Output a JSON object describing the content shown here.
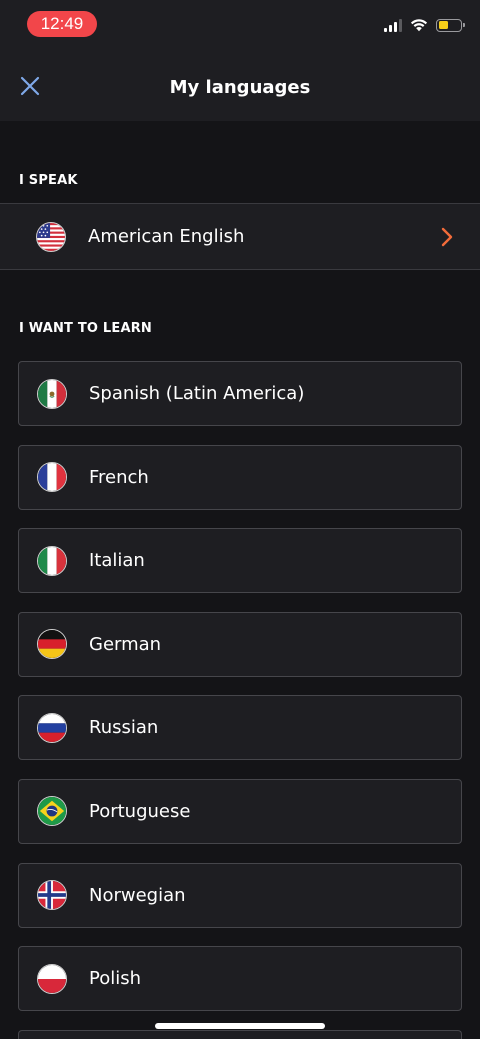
{
  "status_bar": {
    "time": "12:49"
  },
  "nav": {
    "title": "My languages",
    "close_icon": "close-icon"
  },
  "speak_section": {
    "label": "I SPEAK",
    "language": {
      "name": "American English",
      "flag": "us-flag-icon"
    }
  },
  "learn_section": {
    "label": "I WANT TO LEARN",
    "languages": [
      {
        "name": "Spanish (Latin America)",
        "flag": "mexico-flag-icon"
      },
      {
        "name": "French",
        "flag": "france-flag-icon"
      },
      {
        "name": "Italian",
        "flag": "italy-flag-icon"
      },
      {
        "name": "German",
        "flag": "germany-flag-icon"
      },
      {
        "name": "Russian",
        "flag": "russia-flag-icon"
      },
      {
        "name": "Portuguese",
        "flag": "brazil-flag-icon"
      },
      {
        "name": "Norwegian",
        "flag": "norway-flag-icon"
      },
      {
        "name": "Polish",
        "flag": "poland-flag-icon"
      }
    ]
  },
  "colors": {
    "accent": "#f26b3a",
    "close_icon": "#7fa8e8",
    "background": "#141417",
    "card": "#1e1e22"
  }
}
